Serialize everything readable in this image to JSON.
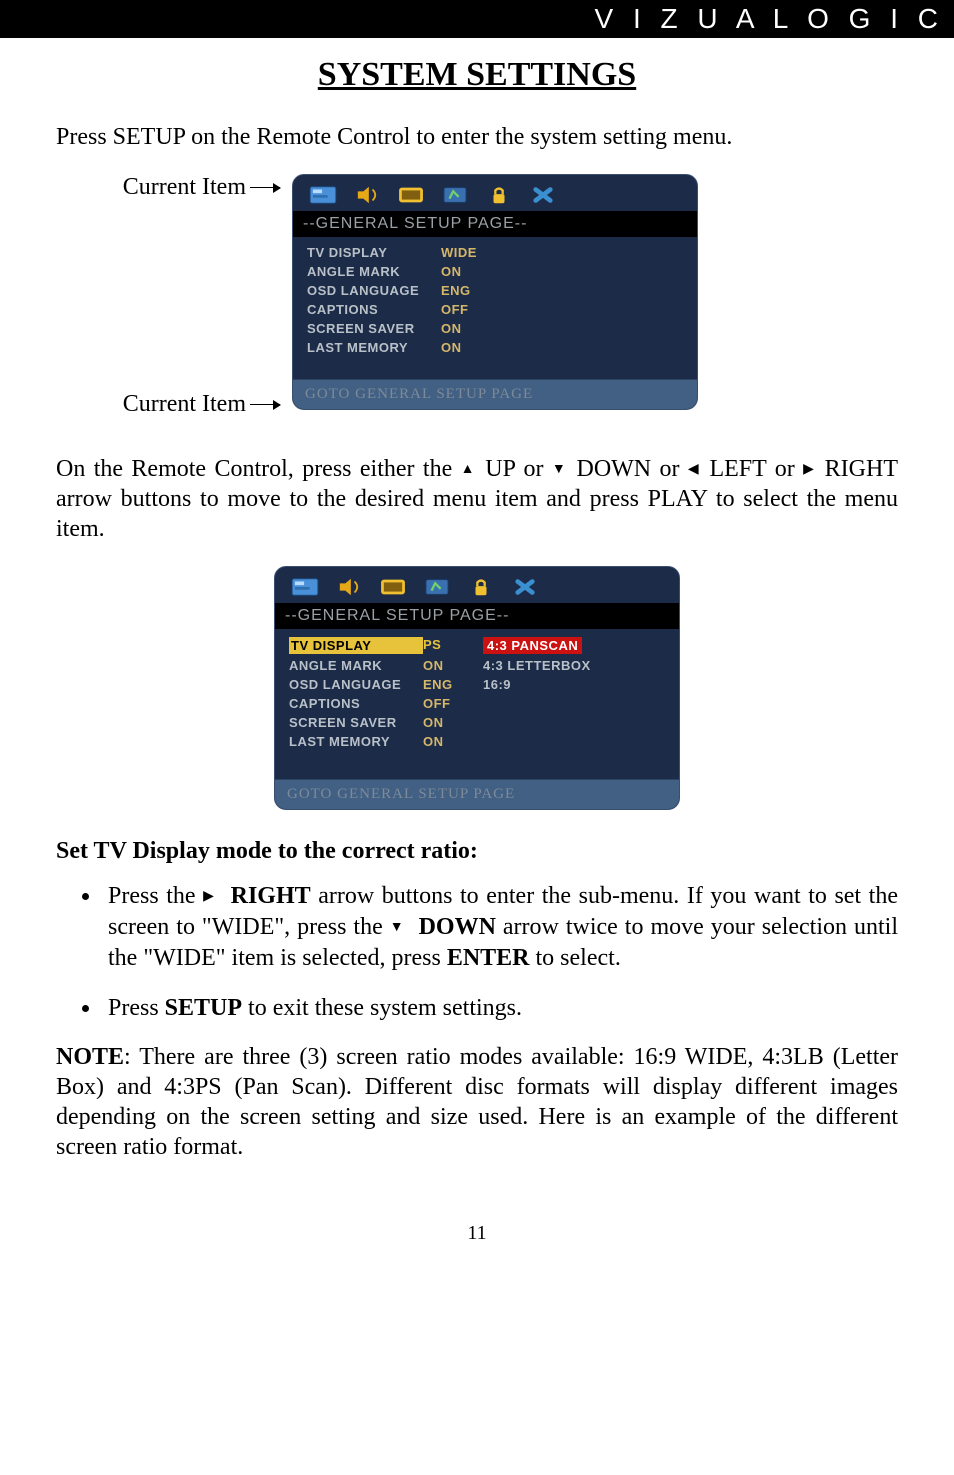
{
  "logo": "V I Z U A L O G I C",
  "title": "SYSTEM SETTINGS",
  "intro": "Press SETUP on the Remote Control to enter the system setting menu.",
  "label_current_top": "Current Item",
  "label_current_bot": "Current Item",
  "osd1": {
    "header": "--GENERAL SETUP PAGE--",
    "rows": [
      {
        "k": "TV DISPLAY",
        "v": "WIDE"
      },
      {
        "k": "ANGLE MARK",
        "v": "ON"
      },
      {
        "k": "OSD LANGUAGE",
        "v": "ENG"
      },
      {
        "k": "CAPTIONS",
        "v": "OFF"
      },
      {
        "k": "SCREEN SAVER",
        "v": "ON"
      },
      {
        "k": "LAST MEMORY",
        "v": "ON"
      }
    ],
    "footer": "GOTO GENERAL SETUP PAGE"
  },
  "para2a": "On the Remote Control, press either the ",
  "para2b": " UP or ",
  "para2c": " DOWN or ",
  "para2d": " LEFT or ",
  "para2e": " RIGHT arrow buttons to move to the desired menu item and press PLAY to select the menu item.",
  "osd2": {
    "header": "--GENERAL SETUP PAGE--",
    "rows": [
      {
        "k": "TV DISPLAY",
        "v": "PS",
        "o": "4:3 PANSCAN",
        "sel": true,
        "red": true
      },
      {
        "k": "ANGLE MARK",
        "v": "ON",
        "o": "4:3 LETTERBOX"
      },
      {
        "k": "OSD LANGUAGE",
        "v": "ENG",
        "o": "16:9"
      },
      {
        "k": "CAPTIONS",
        "v": "OFF",
        "o": ""
      },
      {
        "k": "SCREEN SAVER",
        "v": "ON",
        "o": ""
      },
      {
        "k": "LAST MEMORY",
        "v": "ON",
        "o": ""
      }
    ],
    "footer": "GOTO GENERAL SETUP PAGE"
  },
  "section_h": "Set TV Display mode to the correct ratio:",
  "b1a": "Press the  ",
  "b1b": "RIGHT",
  "b1c": " arrow buttons to enter the sub-menu.  If you want to set the screen to \"WIDE\", press the ",
  "b1d": "DOWN",
  "b1e": " arrow twice to move your selection until the \"WIDE\" item is selected, press ",
  "b1f": "ENTER",
  "b1g": " to select.",
  "b2a": "Press ",
  "b2b": "SETUP",
  "b2c": " to exit these system settings.",
  "note_label": "NOTE",
  "note_body": ": There are three (3) screen ratio modes available: 16:9 WIDE, 4:3LB (Letter Box) and 4:3PS (Pan Scan).  Different disc formats will display different images depending on the screen setting and size used.  Here is an example of the different screen ratio format.",
  "pagenum": "11",
  "glyph": {
    "up": "▲",
    "down": "▼",
    "left": "◀",
    "right": "▶"
  }
}
